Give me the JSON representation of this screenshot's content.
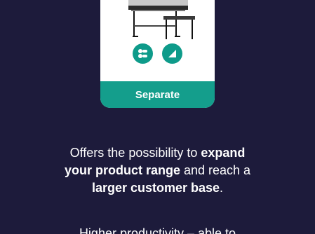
{
  "card": {
    "label": "Separate"
  },
  "icons": {
    "left": "roller-icon",
    "right": "cut-icon"
  },
  "text": {
    "line1_a": "Offers the possibility to ",
    "line1_b": "expand",
    "line2_a": "your product range",
    "line2_b": " and reach a",
    "line3_a": "larger customer base",
    "line3_b": ".",
    "cutoff": "Higher productivity – able to"
  },
  "colors": {
    "background": "#1d1b3b",
    "accent": "#149e8c",
    "card": "#ffffff"
  }
}
